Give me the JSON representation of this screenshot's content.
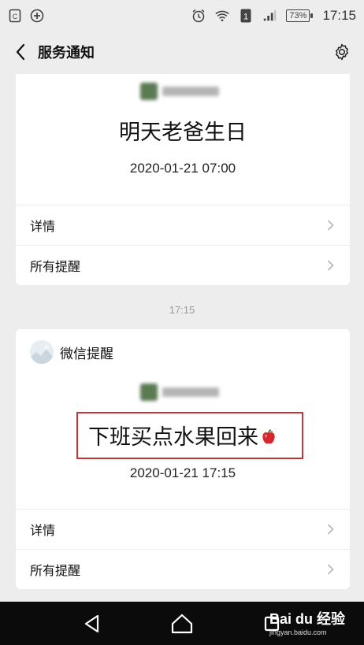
{
  "status_bar": {
    "time": "17:15",
    "battery": "73%",
    "sim_badge": "1",
    "icons": [
      "sim-icon",
      "data-saver-icon",
      "alarm-icon",
      "wifi-icon",
      "sim-badge-icon",
      "signal-icon",
      "battery-icon"
    ]
  },
  "header": {
    "title": "服务通知",
    "back_icon": "chevron-left-icon",
    "settings_icon": "gear-icon"
  },
  "notifications": [
    {
      "title": "明天老爸生日",
      "date": "2020-01-21 07:00",
      "rows": [
        {
          "label": "详情"
        },
        {
          "label": "所有提醒"
        }
      ]
    },
    {
      "timestamp": "17:15",
      "sender": "微信提醒",
      "title": "下班买点水果回来",
      "title_emoji": "apple-icon",
      "date": "2020-01-21 17:15",
      "rows": [
        {
          "label": "详情"
        },
        {
          "label": "所有提醒"
        }
      ],
      "highlight_color": "#c0343a"
    }
  ],
  "watermark": {
    "brand": "Bai du 经验",
    "url": "jingyan.baidu.com"
  },
  "colors": {
    "background": "#ededed",
    "card": "#ffffff",
    "navbar": "#0b0b0b"
  }
}
